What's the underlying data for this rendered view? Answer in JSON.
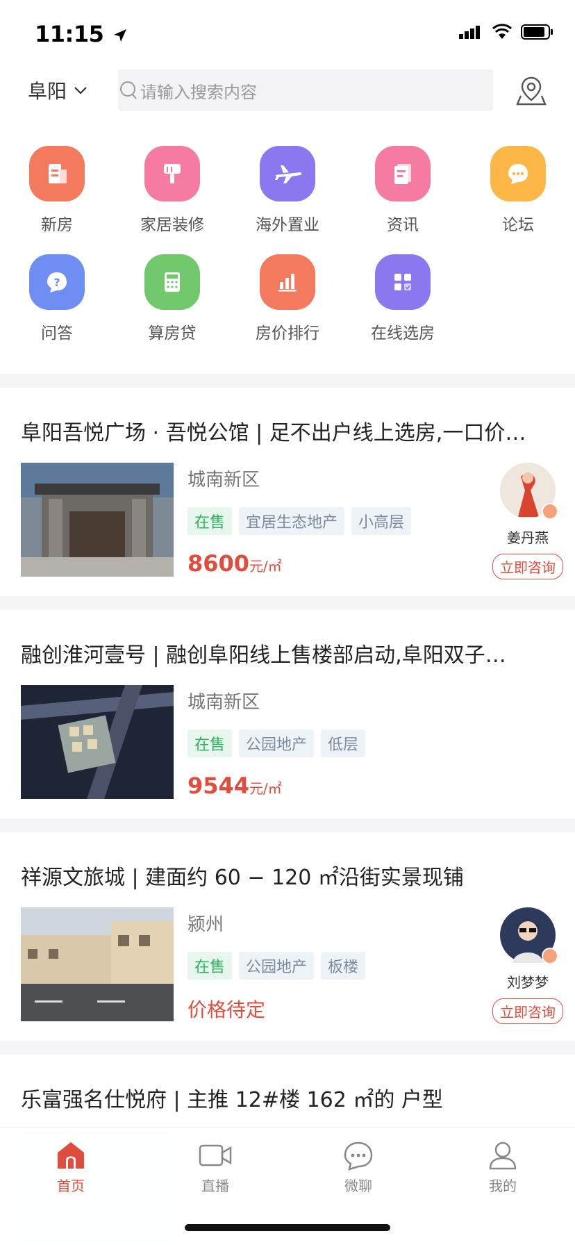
{
  "status_bar": {
    "time": "11:15"
  },
  "header": {
    "city": "阜阳",
    "search_placeholder": "请输入搜索内容"
  },
  "categories": [
    {
      "label": "新房",
      "icon": "new-house-icon",
      "color": "#f47a5e"
    },
    {
      "label": "家居装修",
      "icon": "paint-brush-icon",
      "color": "#f67ba3"
    },
    {
      "label": "海外置业",
      "icon": "airplane-icon",
      "color": "#8b78f0"
    },
    {
      "label": "资讯",
      "icon": "news-icon",
      "color": "#f67ba3"
    },
    {
      "label": "论坛",
      "icon": "chat-bubble-icon",
      "color": "#fcb746"
    },
    {
      "label": "问答",
      "icon": "question-icon",
      "color": "#6f8ef3"
    },
    {
      "label": "算房贷",
      "icon": "calculator-icon",
      "color": "#72c86d"
    },
    {
      "label": "房价排行",
      "icon": "bar-chart-icon",
      "color": "#f47a5e"
    },
    {
      "label": "在线选房",
      "icon": "grid-select-icon",
      "color": "#8b78f0"
    }
  ],
  "listings": [
    {
      "title": "阜阳吾悦广场 · 吾悦公馆 | 足不出户线上选房,一口价…",
      "area": "城南新区",
      "tags": [
        "在售",
        "宜居生态地产",
        "小高层"
      ],
      "price": "8600",
      "price_unit": "元/㎡",
      "agent": {
        "name": "姜丹燕",
        "consult": "立即咨询"
      }
    },
    {
      "title": "融创淮河壹号 | 融创阜阳线上售楼部启动,阜阳双子…",
      "area": "城南新区",
      "tags": [
        "在售",
        "公园地产",
        "低层"
      ],
      "price": "9544",
      "price_unit": "元/㎡"
    },
    {
      "title": "祥源文旅城 | 建面约 60 − 120 ㎡沿街实景现铺",
      "area": "颍州",
      "tags": [
        "在售",
        "公园地产",
        "板楼"
      ],
      "price_text": "价格待定",
      "agent": {
        "name": "刘梦梦",
        "consult": "立即咨询"
      }
    },
    {
      "title": "乐富强名仕悦府 |  主推 12#楼 162 ㎡的 户型"
    }
  ],
  "tabbar": [
    {
      "label": "首页",
      "icon": "home-icon",
      "active": true
    },
    {
      "label": "直播",
      "icon": "video-camera-icon",
      "active": false
    },
    {
      "label": "微聊",
      "icon": "chat-icon",
      "active": false
    },
    {
      "label": "我的",
      "icon": "user-icon",
      "active": false
    }
  ],
  "colors": {
    "accent": "#e14d3d",
    "sale_green": "#2bb35e",
    "tag_gray": "#7a8b9e"
  }
}
